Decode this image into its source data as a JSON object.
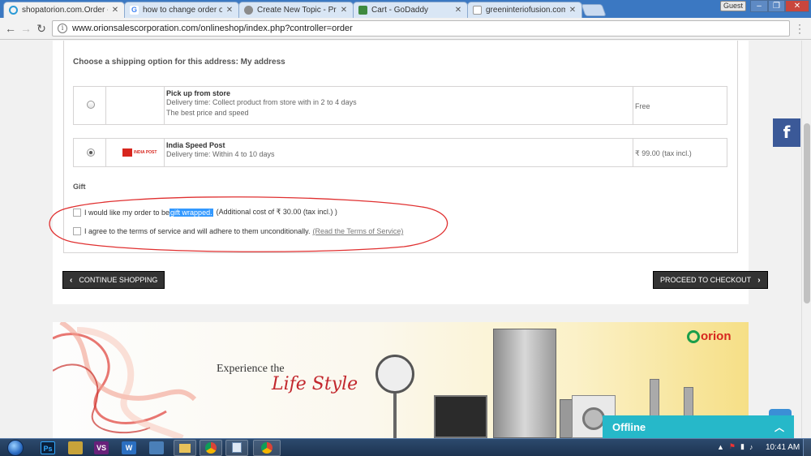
{
  "browser": {
    "tabs": [
      {
        "title": "shopatorion.com.Order -",
        "active": true,
        "favicon_color": "#2a9ad6"
      },
      {
        "title": "how to change order of f",
        "active": false,
        "favicon_color": "#4285f4"
      },
      {
        "title": "Create New Topic - Presta",
        "active": false,
        "favicon_color": "#8b8b8b"
      },
      {
        "title": "Cart - GoDaddy",
        "active": false,
        "favicon_color": "#3f8a3f"
      },
      {
        "title": "greeninteriofusion.com",
        "active": false,
        "favicon_color": "#ffffff"
      }
    ],
    "guest_label": "Guest",
    "url": "www.orionsalescorporation.com/onlineshop/index.php?controller=order"
  },
  "shipping": {
    "title": "Choose a shipping option for this address: My address",
    "options": [
      {
        "name": "Pick up from store",
        "lines": [
          "Delivery time: Collect product from store with in 2 to 4 days",
          "The best price and speed"
        ],
        "price": "Free",
        "selected": false,
        "logo": ""
      },
      {
        "name": "India Speed Post",
        "lines": [
          "Delivery time: Within 4 to 10 days"
        ],
        "price": "₹ 99.00 (tax incl.)",
        "selected": true,
        "logo": "INDIA POST"
      }
    ]
  },
  "gift": {
    "title": "Gift",
    "gift_prefix": "I would like my order to be",
    "gift_highlight": "gift wrapped.",
    "gift_suffix": "(Additional cost of ₹ 30.00 (tax incl.) )",
    "tos_text": "I agree to the terms of service and will adhere to them unconditionally.",
    "tos_link": "(Read the Terms of Service)"
  },
  "buttons": {
    "continue": "CONTINUE SHOPPING",
    "checkout": "PROCEED TO CHECKOUT"
  },
  "banner": {
    "line1": "Experience the",
    "line2": "Life Style",
    "brand": "orion"
  },
  "chat": {
    "status": "Offline"
  },
  "taskbar": {
    "clock": "10:41 AM",
    "apps": [
      "Ps",
      "VS",
      "W"
    ]
  },
  "colors": {
    "accent": "#3b78c2",
    "facebook": "#3b5998",
    "chat": "#26b8c9",
    "highlight": "#3399ff",
    "brand_red": "#d7261e"
  }
}
